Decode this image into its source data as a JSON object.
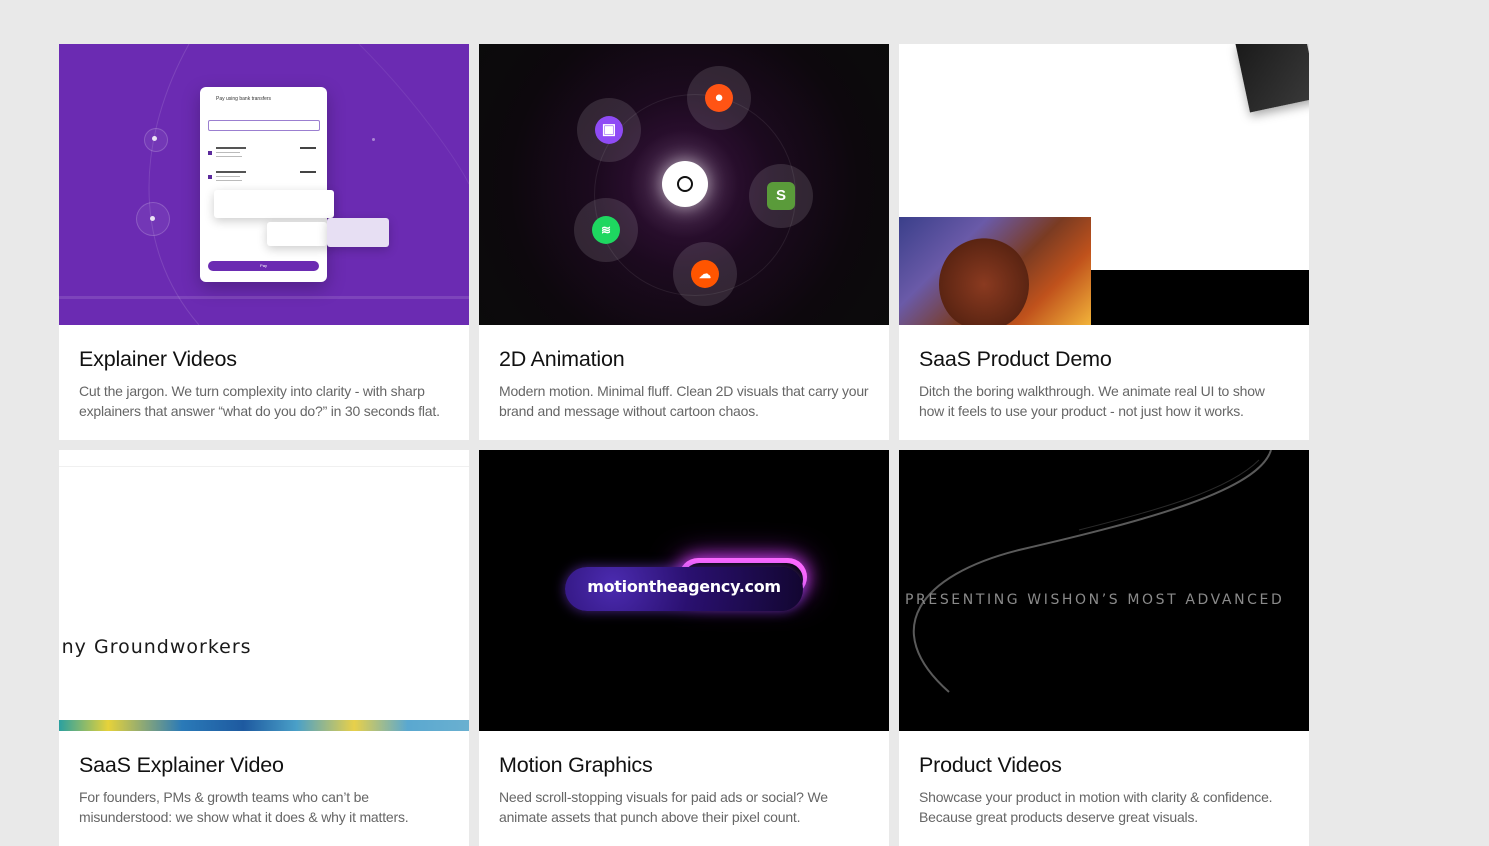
{
  "cards": [
    {
      "title": "Explainer Videos",
      "desc": "Cut the jargon. We turn complexity into clarity - with sharp explainers that answer “what do you do?” in 30 seconds flat.",
      "thumb": {
        "header": "Pay using bank transfers",
        "pay_label": "Pay"
      }
    },
    {
      "title": "2D Animation",
      "desc": "Modern motion. Minimal fluff. Clean 2D visuals that carry your brand and message without cartoon chaos.",
      "thumb": {
        "icons": [
          "twitch-icon",
          "reddit-icon",
          "shopify-icon",
          "soundcloud-icon",
          "spotify-icon"
        ]
      }
    },
    {
      "title": "SaaS Product Demo",
      "desc": "Ditch the boring walkthrough. We animate real UI to show how it feels to use your product - not just how it works."
    },
    {
      "title": "SaaS Explainer Video",
      "desc": "For founders, PMs & growth teams who can’t be misunderstood: we show what it does & why it matters.",
      "thumb": {
        "text": "any Groundworkers"
      }
    },
    {
      "title": "Motion Graphics",
      "desc": "Need scroll-stopping visuals for paid ads or social? We animate assets that punch above their pixel count.",
      "thumb": {
        "text": "motiontheagency.com"
      }
    },
    {
      "title": "Product Videos",
      "desc": "Showcase your product in motion with clarity & confidence. Because great products deserve great visuals.",
      "thumb": {
        "text": "PRESENTING WISHON’S MOST ADVANCED"
      }
    }
  ],
  "colors": {
    "background": "#e9e9e9",
    "card": "#ffffff",
    "purple": "#6b2bb2"
  }
}
